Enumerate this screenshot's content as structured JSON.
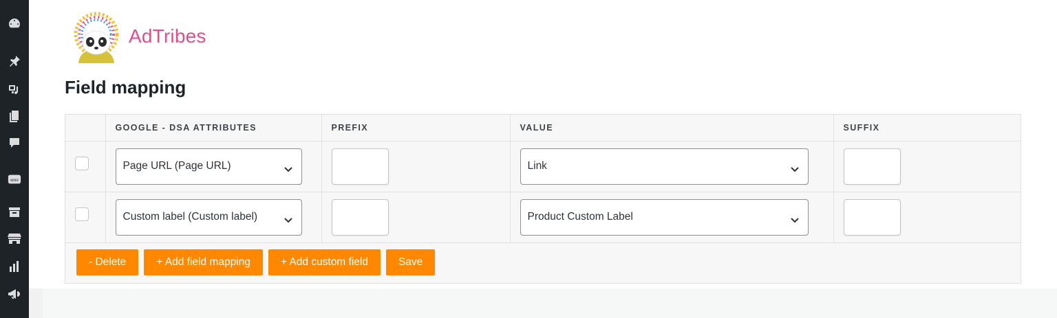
{
  "sidebar": {
    "icons": [
      "dashboard-icon",
      "pin-icon",
      "media-icon",
      "pages-icon",
      "comments-icon",
      "woo-icon",
      "archive-icon",
      "store-icon",
      "analytics-icon",
      "marketing-icon"
    ],
    "woo_label": "woo"
  },
  "brand": {
    "name": "AdTribes"
  },
  "page": {
    "title": "Field mapping"
  },
  "table": {
    "headers": [
      "GOOGLE - DSA ATTRIBUTES",
      "PREFIX",
      "VALUE",
      "SUFFIX"
    ],
    "rows": [
      {
        "attribute": "Page URL (Page URL)",
        "prefix": "",
        "value": "Link",
        "suffix": ""
      },
      {
        "attribute": "Custom label (Custom label)",
        "prefix": "",
        "value": "Product Custom Label",
        "suffix": ""
      }
    ]
  },
  "actions": {
    "delete_label": "- Delete",
    "add_field_label": "+ Add field mapping",
    "add_custom_label": "+ Add custom field",
    "save_label": "Save"
  },
  "colors": {
    "accent": "#ff8800",
    "brand": "#e94a8c",
    "sidebar": "#1d2327"
  }
}
